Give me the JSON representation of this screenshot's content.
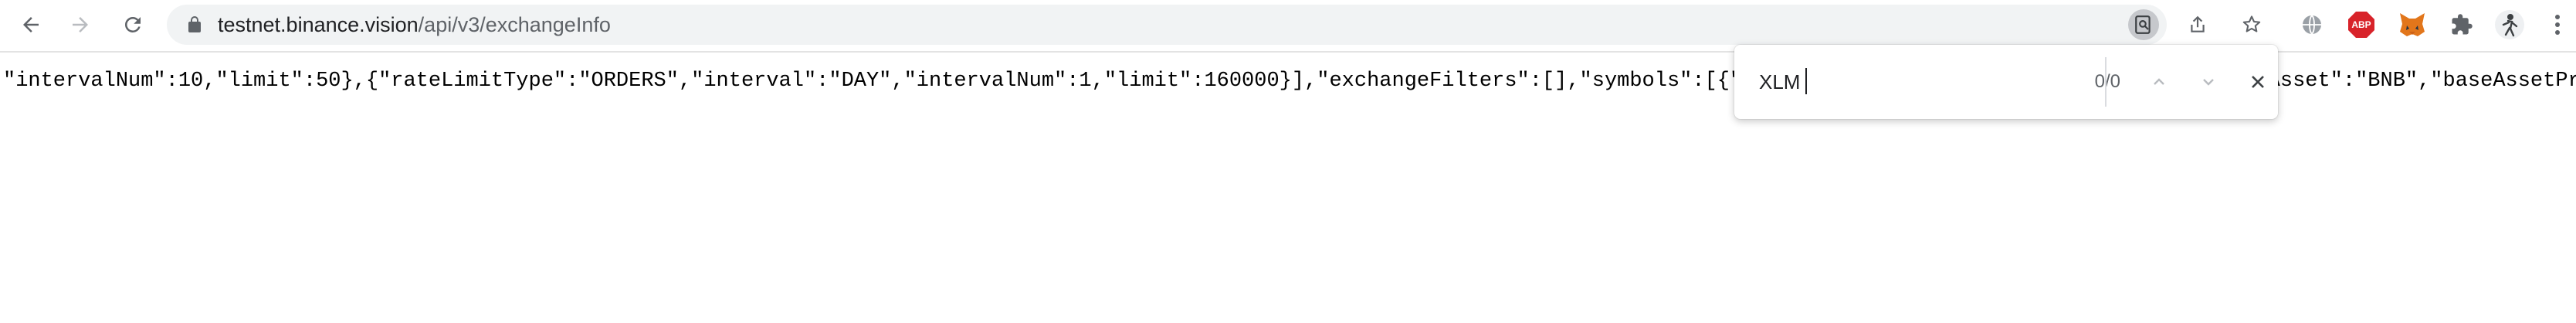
{
  "toolbar": {
    "back_icon": "back-arrow-icon",
    "forward_icon": "forward-arrow-icon",
    "reload_icon": "reload-icon",
    "url_host": "testnet.binance.vision",
    "url_path": "/api/v3/exchangeInfo",
    "right_icons": [
      "zoom-find-icon",
      "share-icon",
      "bookmark-star-icon"
    ],
    "extensions": [
      "globe-extension-icon",
      "adblock-plus-icon",
      "metamask-fox-icon",
      "puzzle-extensions-icon",
      "profile-avatar-icon",
      "kebab-menu-icon"
    ],
    "abp_text": "ABP"
  },
  "content": {
    "json_text": "\"intervalNum\":10,\"limit\":50},{\"rateLimitType\":\"ORDERS\",\"interval\":\"DAY\",\"intervalNum\":1,\"limit\":160000}],\"exchangeFilters\":[],\"symbols\":[{\"symbol\":\"BNBBUSD\",\"status\":\"TRADING\",\"baseAsset\":\"BNB\",\"baseAssetPrecision\""
  },
  "find_bar": {
    "query": "XLM",
    "count": "0/0"
  },
  "colors": {
    "toolbar_bg": "#ffffff",
    "omnibox_bg": "#f1f3f4",
    "icon": "#5f6368",
    "abp_red": "#d8232a",
    "metamask_orange": "#e2761b"
  }
}
